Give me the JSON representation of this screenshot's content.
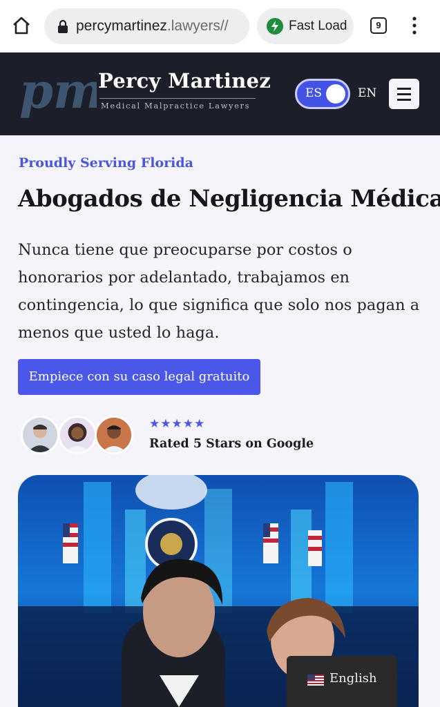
{
  "browser": {
    "url_host": "percymartinez",
    "url_rest": ".lawyers//",
    "fast_load_label": "Fast Load",
    "tab_count": "9",
    "icons": [
      "home-icon",
      "lock-icon",
      "bolt-icon",
      "tabs-icon",
      "more-vert-icon"
    ]
  },
  "header": {
    "logo_monogram": "pm",
    "logo_name": "Percy Martinez",
    "logo_tagline": "Medical Malpractice Lawyers",
    "lang_active": "ES",
    "lang_other": "EN",
    "menu_icon": "hamburger-icon"
  },
  "hero": {
    "eyebrow": "Proudly Serving Florida",
    "title": "Abogados de Negligencia Médica",
    "lead": "Nunca tiene que preocuparse por costos o honorarios por adelantado, trabajamos en contingencia, lo que significa que solo nos pagan a menos que usted lo haga.",
    "cta_label": "Empiece con su caso legal gratuito",
    "stars": "★★★★★",
    "rating_text": "Rated 5 Stars on Google"
  },
  "language_widget": {
    "label": "English",
    "icon": "us-flag-icon"
  },
  "colors": {
    "accent": "#4a57e8",
    "header_bg": "#1c1e2a",
    "page_bg": "#f4f4fa"
  }
}
